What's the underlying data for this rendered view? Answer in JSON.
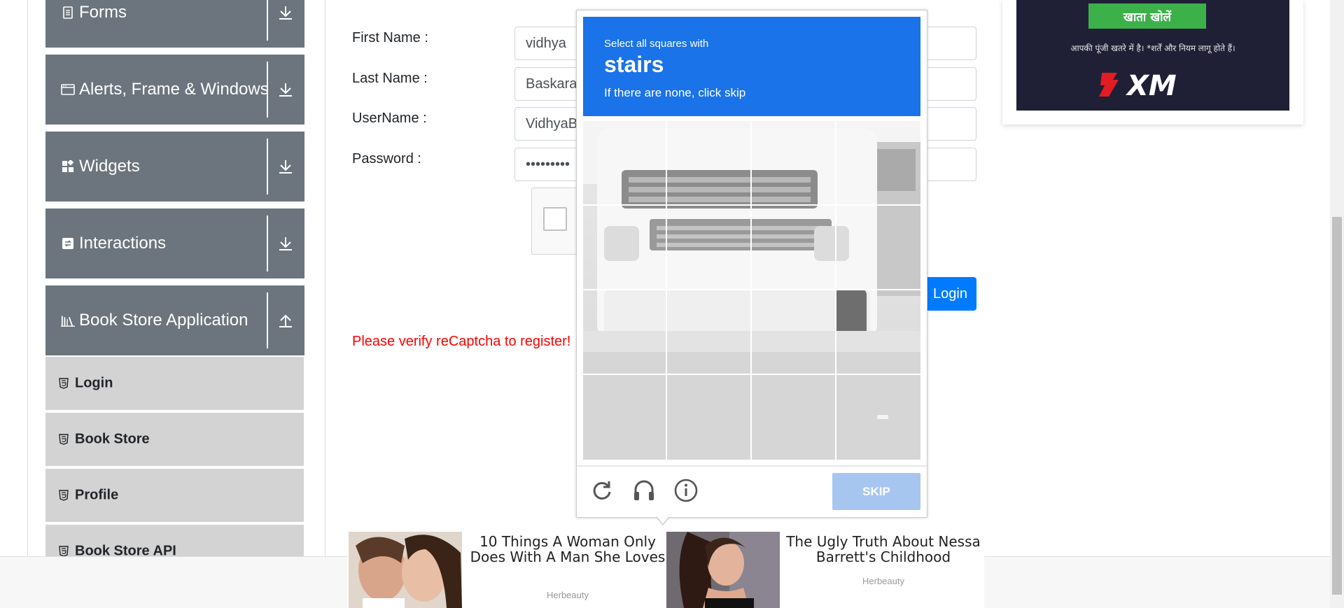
{
  "sidebar": {
    "groups": [
      {
        "label": "Forms",
        "icon": "form-icon",
        "toggle": "expand-icon"
      },
      {
        "label": "Alerts, Frame & Windows",
        "icon": "window-icon",
        "toggle": "expand-icon"
      },
      {
        "label": "Widgets",
        "icon": "widgets-icon",
        "toggle": "expand-icon"
      },
      {
        "label": "Interactions",
        "icon": "interactions-icon",
        "toggle": "expand-icon"
      },
      {
        "label": "Book Store Application",
        "icon": "books-icon",
        "toggle": "collapse-icon"
      }
    ],
    "items": [
      {
        "label": "Login",
        "icon": "html5-icon"
      },
      {
        "label": "Book Store",
        "icon": "html5-icon"
      },
      {
        "label": "Profile",
        "icon": "html5-icon"
      },
      {
        "label": "Book Store API",
        "icon": "html5-icon"
      }
    ]
  },
  "form": {
    "first_name_label": "First Name :",
    "first_name_value": "vidhya",
    "last_name_label": "Last Name :",
    "last_name_value": "Baskaran",
    "username_label": "UserName :",
    "username_value": "VidhyaB",
    "password_label": "Password :",
    "password_value": "•••••••••",
    "login_label": "Login",
    "error": "Please verify reCaptcha to register!"
  },
  "captcha": {
    "instruction": "Select all squares with",
    "target": "stairs",
    "hint": "If there are none, click skip",
    "skip_label": "SKIP",
    "footer_icons": [
      "reload-icon",
      "audio-icon",
      "info-icon"
    ]
  },
  "ad_top": {
    "button": "खाता खोलें",
    "disclaimer": "आपकी पूंजी खतरे में है। *शर्तें और नियम लागू होते हैं।",
    "brand": "XM",
    "colors": {
      "background": "#1f2036",
      "button": "#3cb14a",
      "logo": "#e31b23"
    }
  },
  "bottom_ads": [
    {
      "title": "10 Things A Woman Only Does With A Man She Loves",
      "source": "Herbeauty"
    },
    {
      "title": "The Ugly Truth About Nessa Barrett's Childhood",
      "source": "Herbeauty"
    }
  ],
  "colors": {
    "sidebar_header": "#6c757d",
    "sidebar_item": "#d3d3d3",
    "primary": "#007bff",
    "captcha_header": "#1a73e8",
    "error": "#ff0000"
  }
}
